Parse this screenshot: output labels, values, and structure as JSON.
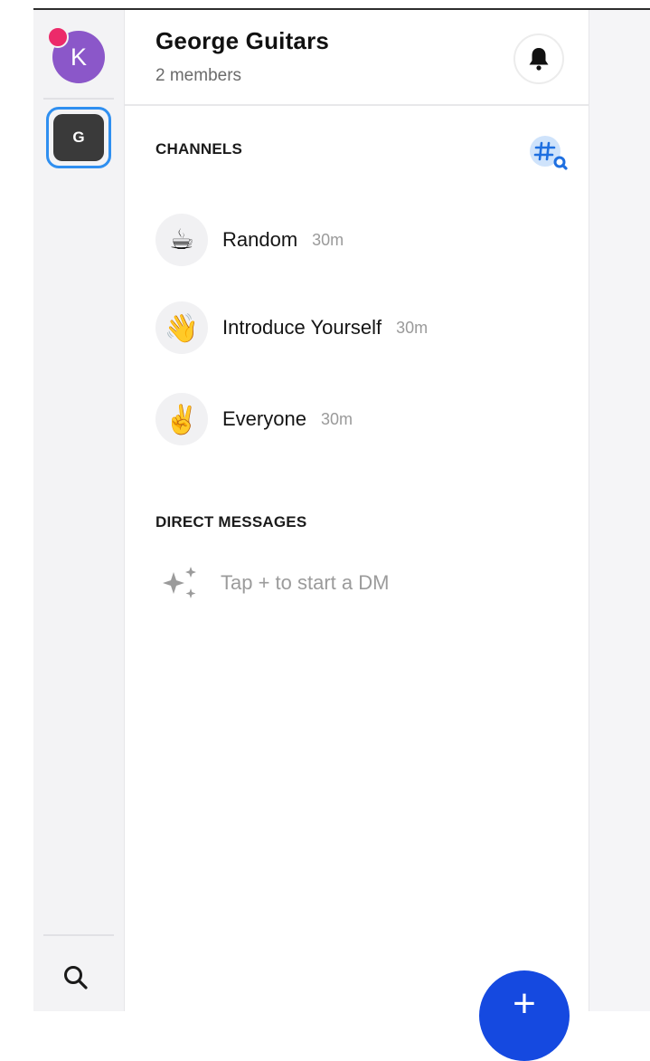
{
  "rail": {
    "profile_initial": "K",
    "server_initial": "G"
  },
  "header": {
    "title": "George Guitars",
    "subtitle": "2 members"
  },
  "channels": {
    "label": "CHANNELS",
    "items": [
      {
        "name": "Random",
        "time": "30m",
        "emoji": "☕"
      },
      {
        "name": "Introduce Yourself",
        "time": "30m",
        "emoji": "👋"
      },
      {
        "name": "Everyone",
        "time": "30m",
        "emoji": "✌️"
      }
    ]
  },
  "direct_messages": {
    "label": "DIRECT MESSAGES",
    "empty_text": "Tap + to start a DM"
  },
  "fab": {
    "label": "+"
  },
  "colors": {
    "accent": "#1549e0",
    "server_ring": "#2f8ff0",
    "profile_bg": "#8b57c9",
    "notification_dot": "#ec2a6a"
  }
}
